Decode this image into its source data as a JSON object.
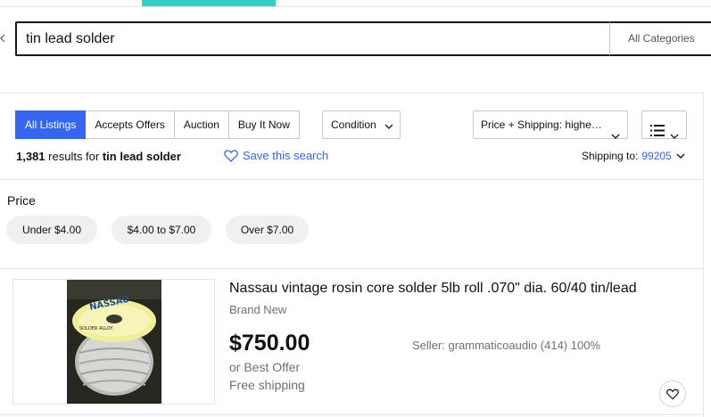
{
  "search": {
    "query": "tin lead solder",
    "category": "All Categories"
  },
  "filters": {
    "tabs": [
      {
        "label": "All Listings",
        "active": true
      },
      {
        "label": "Accepts Offers",
        "active": false
      },
      {
        "label": "Auction",
        "active": false
      },
      {
        "label": "Buy It Now",
        "active": false
      }
    ],
    "condition_label": "Condition",
    "sort_label": "Price + Shipping: highe…"
  },
  "results": {
    "count": "1,381",
    "middle": " results for ",
    "query": "tin lead solder",
    "save_label": "Save this search",
    "shipping_label": "Shipping to:",
    "zip": "99205"
  },
  "price_filter": {
    "heading": "Price",
    "options": [
      "Under $4.00",
      "$4.00 to $7.00",
      "Over $7.00"
    ]
  },
  "listing": {
    "title": "Nassau vintage rosin core solder 5lb roll .070\" dia. 60/40 tin/lead",
    "condition": "Brand New",
    "price": "$750.00",
    "best_offer": "or Best Offer",
    "shipping": "Free shipping",
    "seller": "Seller: grammaticoaudio (414) 100%",
    "image_brand": "NASSAU",
    "image_label": "SOLDER ALLOY"
  },
  "colors": {
    "accent": "#3665f3",
    "teal": "#2fd0c8",
    "pill_bg": "#f0f0f0"
  },
  "icons": [
    "chevron-down-icon",
    "heart-icon",
    "list-view-icon"
  ]
}
